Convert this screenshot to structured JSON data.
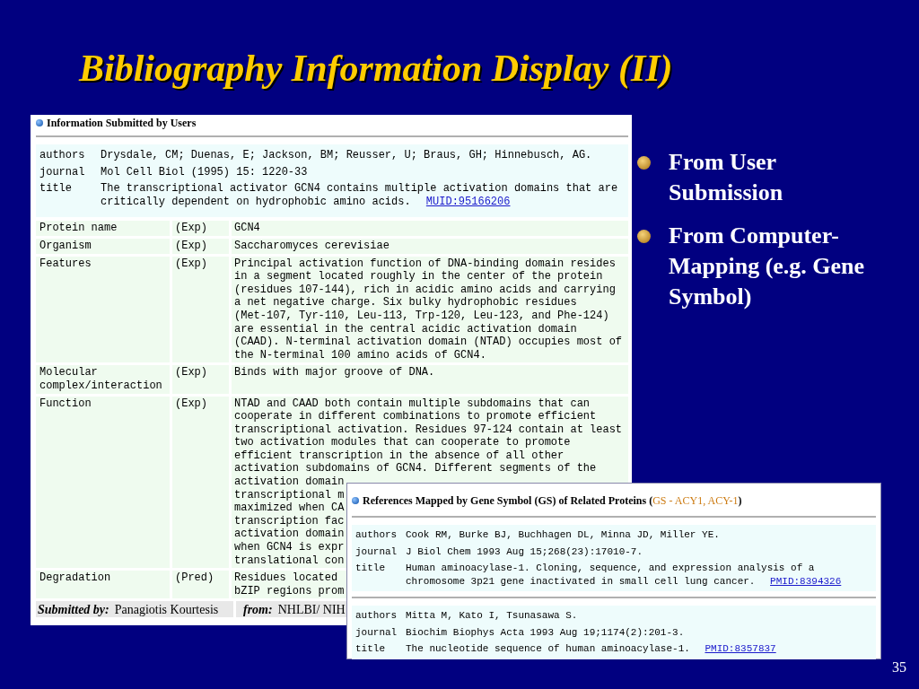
{
  "slide": {
    "title": "Bibliography Information Display (II)",
    "page_number": "35"
  },
  "submission": {
    "heading": "Information Submitted by Users",
    "citation": [
      {
        "label": "authors",
        "value": "Drysdale, CM; Duenas, E; Jackson, BM; Reusser, U; Braus, GH; Hinnebusch, AG."
      },
      {
        "label": "journal",
        "value": "Mol Cell Biol (1995) 15: 1220-33"
      },
      {
        "label": "title",
        "value": "The transcriptional activator GCN4 contains multiple activation domains that are critically dependent on hydrophobic amino acids.",
        "link": "MUID:95166206"
      }
    ],
    "annotations": [
      {
        "label": "Protein name",
        "evidence": "(Exp)",
        "lines": [
          "GCN4"
        ]
      },
      {
        "label": "Organism",
        "evidence": "(Exp)",
        "lines": [
          "Saccharomyces cerevisiae"
        ]
      },
      {
        "label": "Features",
        "evidence": "(Exp)",
        "lines": [
          "Principal activation function of DNA-binding domain resides",
          "in a segment located roughly in the center of the protein",
          "(residues 107-144), rich in acidic amino acids and carrying",
          "a net negative charge. Six bulky hydrophobic residues",
          "(Met-107, Tyr-110, Leu-113, Trp-120, Leu-123, and Phe-124)",
          "are essential in the central acidic activation domain",
          "(CAAD). N-terminal activation domain (NTAD) occupies most of",
          "the N-terminal 100 amino acids of GCN4."
        ]
      },
      {
        "label": "Molecular complex/interaction",
        "evidence": "(Exp)",
        "lines": [
          "Binds with major groove of DNA."
        ]
      },
      {
        "label": "Function",
        "evidence": "(Exp)",
        "lines": [
          "NTAD and CAAD both contain multiple subdomains that can",
          "cooperate in different combinations to promote efficient",
          "transcriptional activation. Residues 97-124 contain at least",
          "two activation modules that can cooperate to promote",
          "efficient transcription in the absence of all other",
          "activation subdomains of GCN4. Different segments of the",
          "activation domain",
          "transcriptional m",
          "maximized when CA",
          "transcription fac",
          "activation domain",
          "when GCN4 is expr",
          "translational con"
        ]
      },
      {
        "label": "Degradation",
        "evidence": "(Pred)",
        "lines": [
          "Residues located",
          "bZIP regions prom"
        ]
      }
    ],
    "footer": {
      "submitted_by_label": "Submitted by:",
      "submitted_by": "Panagiotis Kourtesis",
      "from_label": "from:",
      "from": "NHLBI/ NIH"
    }
  },
  "references": {
    "heading": "References Mapped by Gene Symbol (GS) of Related Proteins",
    "brackets": [
      "(",
      ")"
    ],
    "gene_symbols": "GS - ACY1, ACY-1",
    "items": [
      {
        "fields": [
          {
            "label": "authors",
            "value": "Cook RM, Burke BJ, Buchhagen DL, Minna JD, Miller YE."
          },
          {
            "label": "journal",
            "value": "J Biol Chem 1993 Aug 15;268(23):17010-7."
          },
          {
            "label": "title",
            "value": "Human aminoacylase-1. Cloning, sequence, and expression analysis of a chromosome 3p21 gene inactivated in small cell lung cancer.",
            "link": "PMID:8394326"
          }
        ]
      },
      {
        "fields": [
          {
            "label": "authors",
            "value": "Mitta M, Kato I, Tsunasawa S."
          },
          {
            "label": "journal",
            "value": "Biochim Biophys Acta 1993 Aug 19;1174(2):201-3."
          },
          {
            "label": "title",
            "value": "The nucleotide sequence of human aminoacylase-1.",
            "link": "PMID:8357837"
          }
        ]
      }
    ]
  },
  "bullets": [
    "From User Submission",
    "From Computer-Mapping (e.g. Gene Symbol)"
  ]
}
